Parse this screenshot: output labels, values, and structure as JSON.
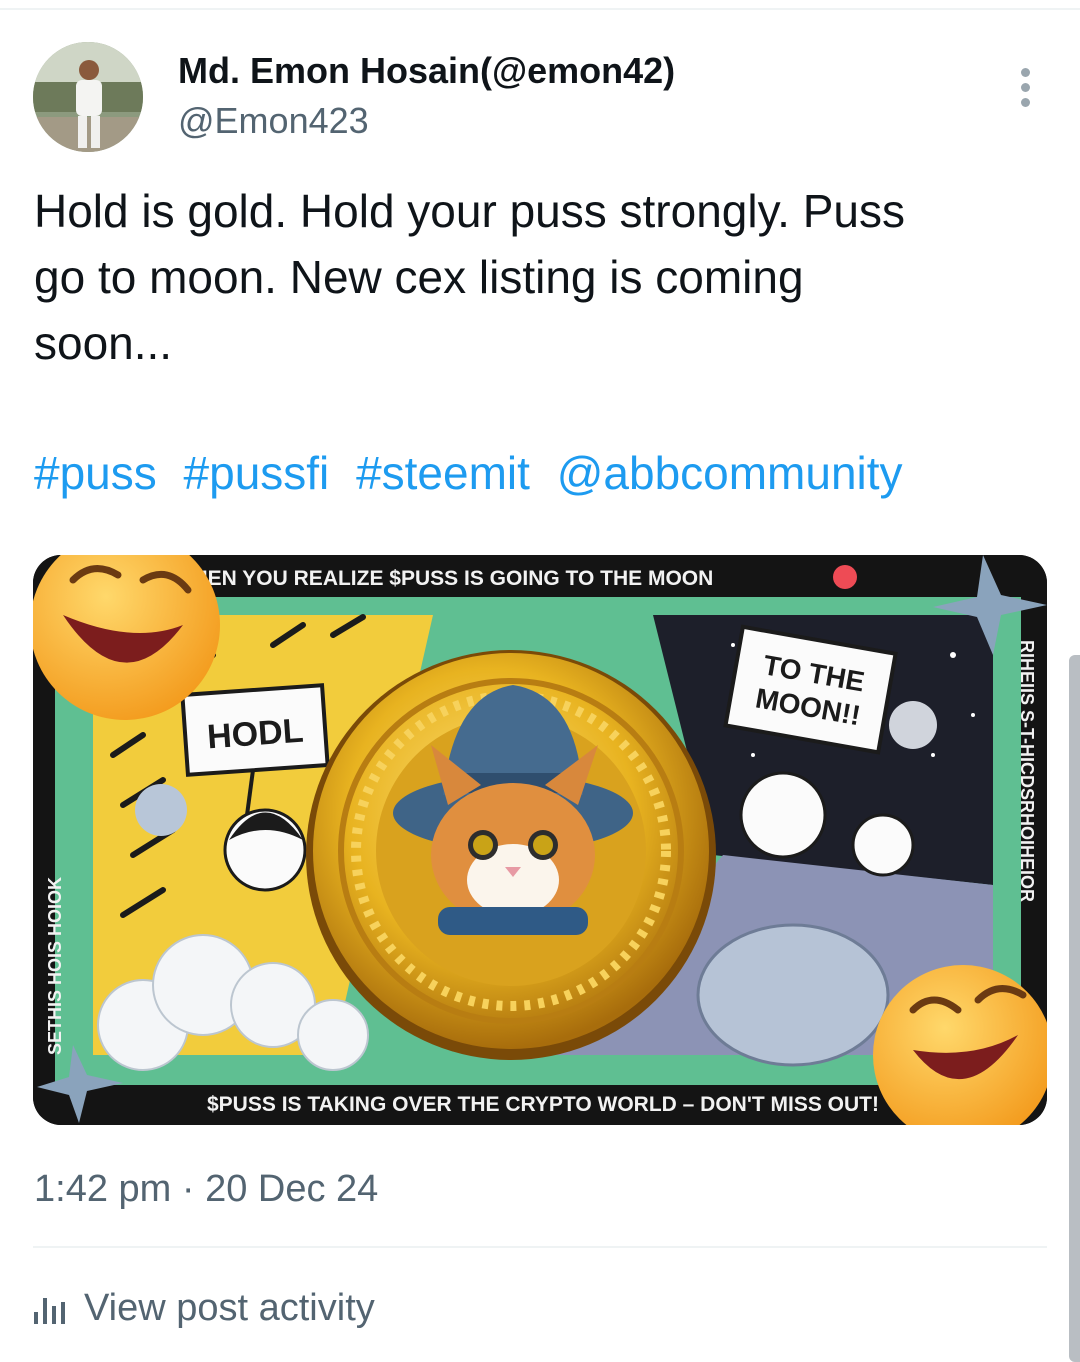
{
  "post": {
    "author": {
      "display_name": "Md. Emon Hosain(@emon42)",
      "handle": "@Emon423"
    },
    "text_lines": [
      "Hold is gold. Hold your puss strongly. Puss",
      "go to moon. New cex listing is coming",
      "soon..."
    ],
    "tags": [
      "#puss",
      "#pussfi",
      "#steemit",
      "@abbcommunity"
    ],
    "timestamp": "1:42 pm · 20 Dec 24",
    "activity_label": "View post activity"
  },
  "media": {
    "top_banner": "WHEN YOU REALIZE $PUSS IS GOING TO THE MOON",
    "bottom_banner": "$PUSS IS TAKING OVER THE CRYPTO WORLD – DON'T MISS OUT!",
    "sign_hodl": "HODL",
    "sign_moon_line1": "TO THE",
    "sign_moon_line2": "MOON!!",
    "side_left": "SETHIS HOIS HOIOK",
    "side_right": "RIHEIIS S-T-HICDSRHOIHEIOR"
  },
  "icons": {
    "more": "more-vertical-icon",
    "activity": "bar-chart-icon"
  },
  "colors": {
    "hashtag": "#1d9bf0",
    "secondary_text": "#536471",
    "coin_gold": "#e8b320",
    "panel_green": "#5fbf92"
  }
}
